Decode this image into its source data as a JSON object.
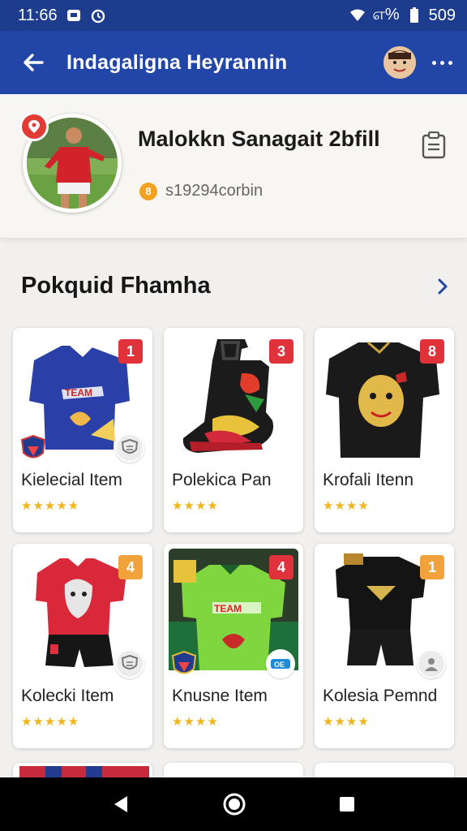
{
  "status": {
    "time": "11:66",
    "right_text": "எ%",
    "battery": "509"
  },
  "appbar": {
    "title": "Indagaligna Heyrannin"
  },
  "profile": {
    "name": "Malokkn Sanagait 2bfill",
    "coin_value": "8",
    "handle": "s19294corbin"
  },
  "section": {
    "title": "Pokquid Fhamha"
  },
  "items": [
    {
      "label": "Kielecial Item",
      "rank": "1",
      "stars": "★★★★★",
      "icon": "shirt-blue-icon"
    },
    {
      "label": "Polekica Pan",
      "rank": "3",
      "stars": "★★★★",
      "icon": "boot-icon"
    },
    {
      "label": "Krofali Itenn",
      "rank": "8",
      "stars": "★★★★",
      "icon": "shirt-black-icon"
    },
    {
      "label": "Kolecki Item",
      "rank": "4",
      "stars": "★★★★★",
      "icon": "shirt-red-icon"
    },
    {
      "label": "Knusne Item",
      "rank": "4",
      "stars": "★★★★",
      "icon": "shirt-green-icon"
    },
    {
      "label": "Kolesia Pemnd",
      "rank": "1",
      "stars": "★★★★",
      "icon": "kit-black-icon"
    }
  ],
  "colors": {
    "appbar": "#2146a8",
    "statusbar": "#1d3c8d",
    "star": "#f1b51c",
    "badge_red": "#e0323a",
    "badge_orange": "#f2a23a"
  }
}
